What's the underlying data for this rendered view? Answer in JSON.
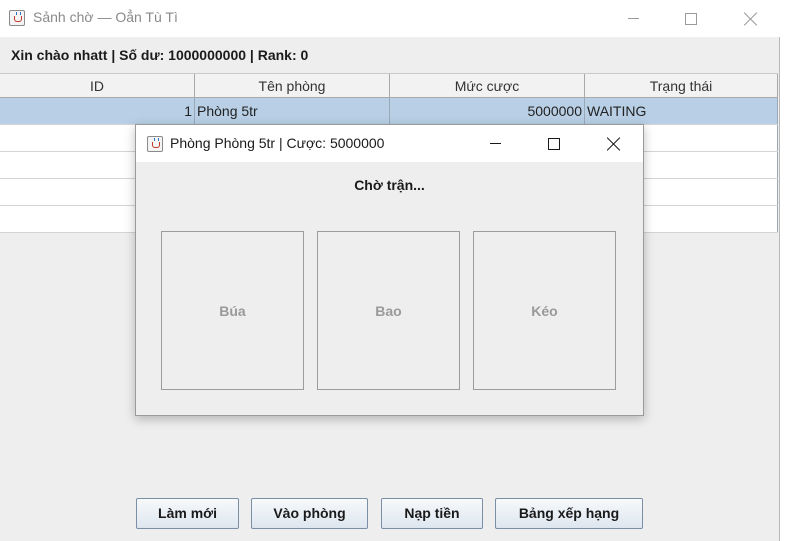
{
  "window": {
    "title": "Sảnh chờ — Oẳn Tù Tì",
    "icon": "java-cup-icon"
  },
  "status_line": "Xin chào nhatt | Số dư: 1000000000 | Rank: 0",
  "table": {
    "headers": [
      "ID",
      "Tên phòng",
      "Mức cược",
      "Trạng thái"
    ],
    "rows": [
      {
        "id": "1",
        "name": "Phòng 5tr",
        "bet": "5000000",
        "status": "WAITING"
      }
    ]
  },
  "buttons": {
    "refresh": "Làm mới",
    "join": "Vào phòng",
    "deposit": "Nạp tiền",
    "leaderboard": "Bảng xếp hạng"
  },
  "dialog": {
    "title": "Phòng Phòng 5tr | Cược: 5000000",
    "status": "Chờ trận...",
    "choices": [
      "Búa",
      "Bao",
      "Kéo"
    ]
  },
  "colors": {
    "selected_row": "#b8cfe5",
    "window_bg": "#eeeeee",
    "button_border": "#7a8ea6"
  }
}
